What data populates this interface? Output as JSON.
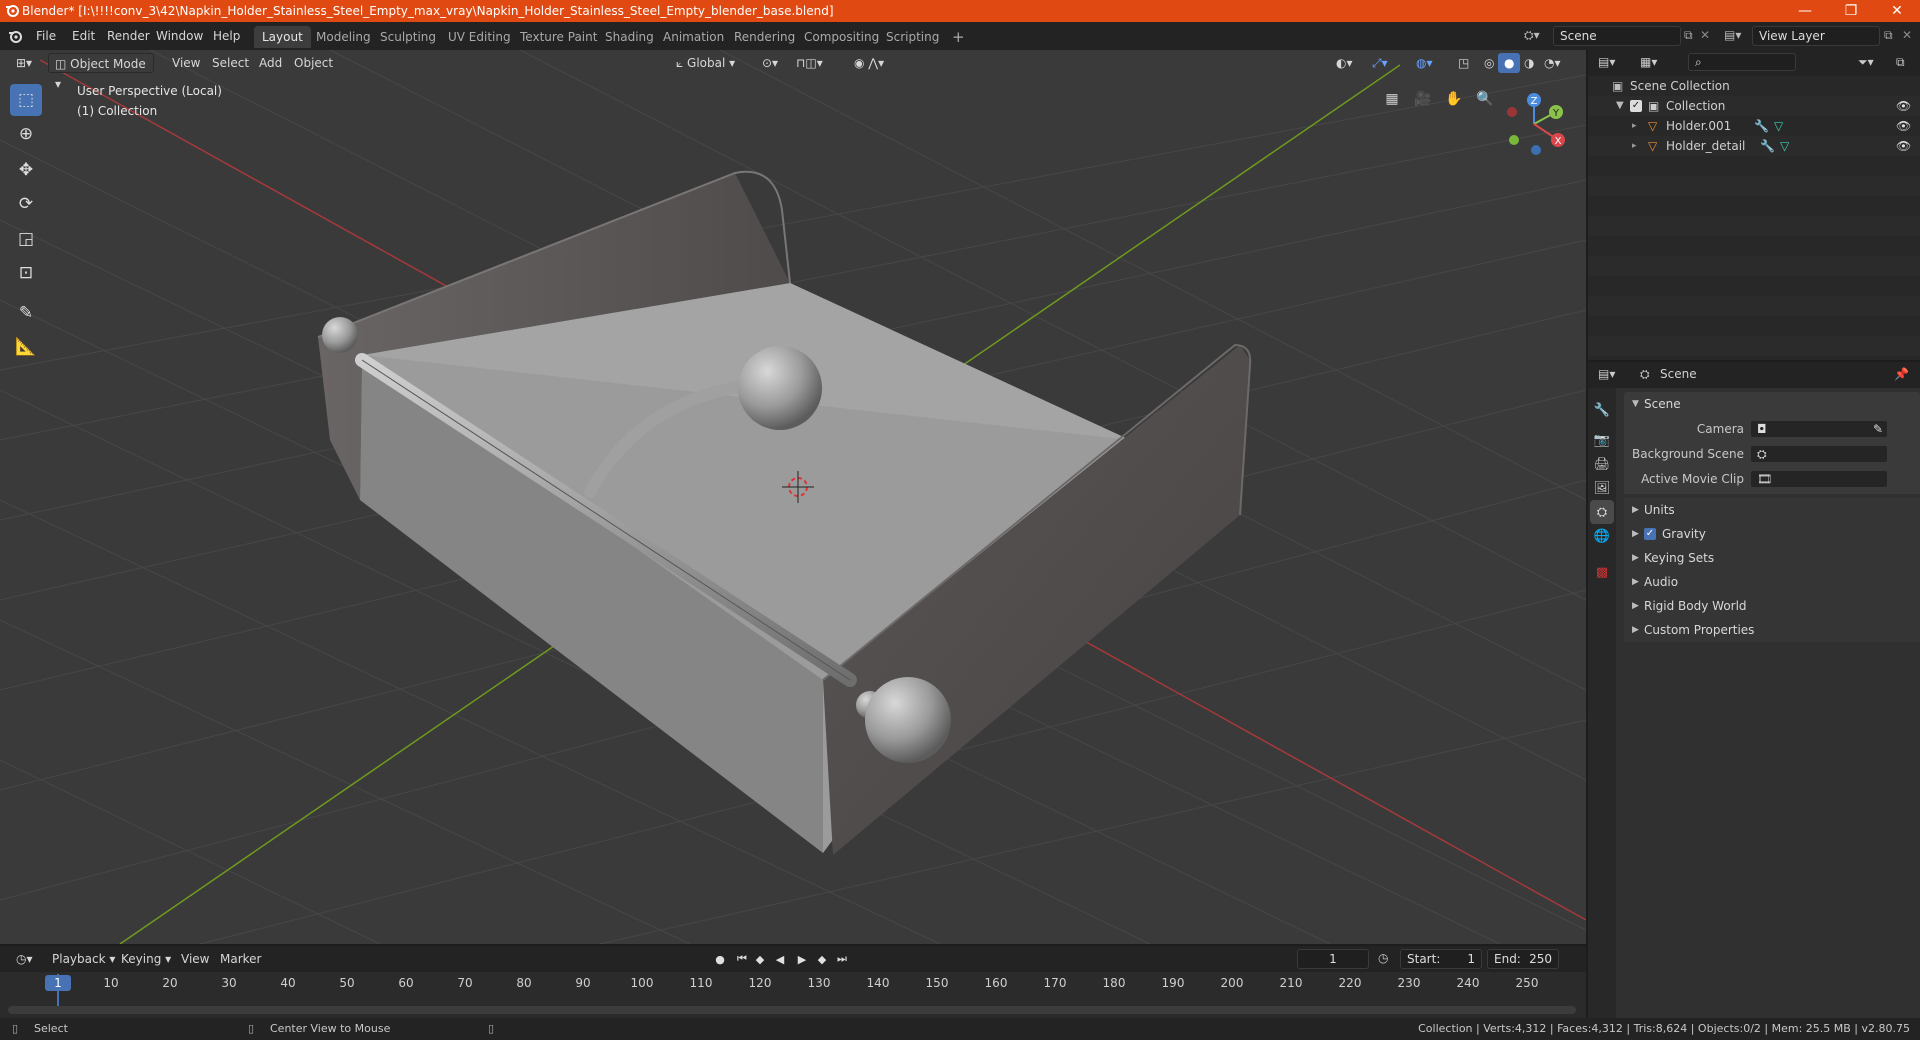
{
  "titlebar": {
    "title": "Blender* [I:\\!!!!conv_3\\42\\Napkin_Holder_Stainless_Steel_Empty_max_vray\\Napkin_Holder_Stainless_Steel_Empty_blender_base.blend]",
    "minimize": "—",
    "maximize": "❐",
    "close": "✕"
  },
  "menubar": {
    "menus": [
      "File",
      "Edit",
      "Render",
      "Window",
      "Help"
    ],
    "workspaces": [
      "Layout",
      "Modeling",
      "Sculpting",
      "UV Editing",
      "Texture Paint",
      "Shading",
      "Animation",
      "Rendering",
      "Compositing",
      "Scripting"
    ],
    "active_workspace": "Layout",
    "add_tab": "+",
    "scene_name": "Scene",
    "view_layer": "View Layer"
  },
  "viewport_header": {
    "mode": "Object Mode",
    "menus": [
      "View",
      "Select",
      "Add",
      "Object"
    ],
    "orientation": "Global"
  },
  "viewport": {
    "perspective_label": "User Perspective (Local)",
    "collection_label": "(1) Collection",
    "gizmo": {
      "z": "Z",
      "y": "Y",
      "x": "X"
    }
  },
  "toolbar": {
    "tools": [
      "select-box",
      "cursor",
      "move",
      "rotate",
      "scale",
      "transform",
      "annotate",
      "measure"
    ],
    "active": "select-box"
  },
  "outliner": {
    "root": "Scene Collection",
    "collection": "Collection",
    "objects": [
      "Holder.001",
      "Holder_detail"
    ]
  },
  "properties": {
    "context": "Scene",
    "panel_title": "Scene",
    "fields": [
      {
        "label": "Camera",
        "value": ""
      },
      {
        "label": "Background Scene",
        "value": ""
      },
      {
        "label": "Active Movie Clip",
        "value": ""
      }
    ],
    "sections": [
      "Units",
      "Gravity",
      "Keying Sets",
      "Audio",
      "Rigid Body World",
      "Custom Properties"
    ],
    "gravity_checked": true
  },
  "timeline": {
    "menus": [
      "Playback",
      "Keying",
      "View",
      "Marker"
    ],
    "current_frame": "1",
    "start_label": "Start:",
    "start": "1",
    "end_label": "End:",
    "end": "250",
    "ticks": [
      "1",
      "10",
      "20",
      "30",
      "40",
      "50",
      "60",
      "70",
      "80",
      "90",
      "100",
      "110",
      "120",
      "130",
      "140",
      "150",
      "160",
      "170",
      "180",
      "190",
      "200",
      "210",
      "220",
      "230",
      "240",
      "250"
    ]
  },
  "statusbar": {
    "left": "Select",
    "middle": "Center View to Mouse",
    "right": "Collection | Verts:4,312 | Faces:4,312 | Tris:8,624 | Objects:0/2 | Mem: 25.5 MB | v2.80.75"
  },
  "colors": {
    "title_bar": "#e04a12",
    "accent": "#4772b3",
    "x_axis": "#d9474a",
    "y_axis": "#8bc34a",
    "z_axis": "#4a8de0"
  }
}
